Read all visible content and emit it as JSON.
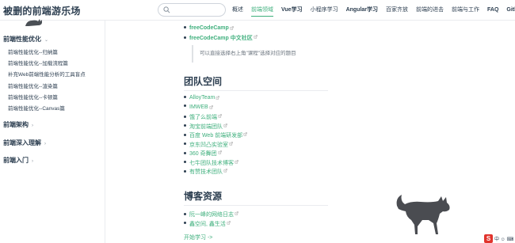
{
  "site": {
    "title": "被删的前端游乐场"
  },
  "search": {
    "placeholder": ""
  },
  "nav": {
    "links": [
      {
        "label": "概述",
        "active": false,
        "bold": false
      },
      {
        "label": "前端领域",
        "active": true,
        "bold": false
      },
      {
        "label": "Vue学习",
        "active": false,
        "bold": true
      },
      {
        "label": "小程序学习",
        "active": false,
        "bold": false
      },
      {
        "label": "Angular学习",
        "active": false,
        "bold": true
      },
      {
        "label": "百家齐放",
        "active": false,
        "bold": false
      },
      {
        "label": "前端的进击",
        "active": false,
        "bold": false
      },
      {
        "label": "前端与工作",
        "active": false,
        "bold": false
      },
      {
        "label": "FAQ",
        "active": false,
        "bold": true
      },
      {
        "label": "Github",
        "active": false,
        "bold": true
      }
    ]
  },
  "sidebar": {
    "cat1": {
      "label": "前端性能优化",
      "arrow": "⌄"
    },
    "items": [
      "前端性能优化--归纳篇",
      "前端性能优化--加载流程篇",
      "补充Web前端性能分析的工具盲点",
      "前端性能优化--渲染篇",
      "前端性能优化--卡顿篇",
      "前端性能优化--Canvas篇"
    ],
    "cat2": {
      "label": "前端架构",
      "arrow": "›"
    },
    "cat3": {
      "label": "前端深入理解",
      "arrow": "›"
    },
    "cat4": {
      "label": "前端入门",
      "arrow": "›"
    }
  },
  "main": {
    "top_links": [
      {
        "text": "freeCodeCamp"
      },
      {
        "text": "freeCodeCamp 中文社区"
      }
    ],
    "tip": "可以直接选择右上角\"课程\"选择对应的题目",
    "team_heading": "团队空间",
    "team_links": [
      "AlloyTeam",
      "IMWEB",
      "饿了么前端",
      "淘宝前端团队",
      "百度 Web 前端研发部",
      "京东凹凸实验室",
      "360 奇舞团",
      "七牛团队技术博客",
      "有赞技术团队"
    ],
    "blog_heading": "博客资源",
    "blog_links": [
      "阮一峰的网络日志",
      "鑫空间, 鑫生活"
    ],
    "start": "开始学习 ->"
  },
  "badge": {
    "s": "S",
    "text": "中 ☺ ⌨"
  },
  "colors": {
    "accent": "#3eaf7c",
    "text": "#2c3e50"
  }
}
